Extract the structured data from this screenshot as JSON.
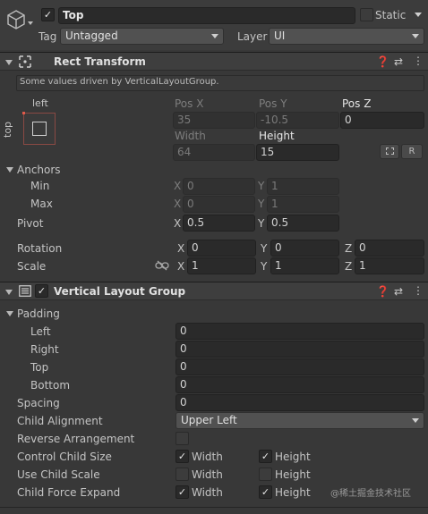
{
  "gameobject": {
    "name": "Top",
    "static_label": "Static",
    "tag_label": "Tag",
    "tag_value": "Untagged",
    "layer_label": "Layer",
    "layer_value": "UI"
  },
  "rect_transform": {
    "title": "Rect Transform",
    "driven_note": "Some values driven by VerticalLayoutGroup.",
    "anchor_h": "left",
    "anchor_v": "top",
    "col1_label": "Pos X",
    "col2_label": "Pos Y",
    "col3_label": "Pos Z",
    "pos_x": "35",
    "pos_y": "-10.5",
    "pos_z": "0",
    "width_label": "Width",
    "height_label": "Height",
    "width": "64",
    "height": "15",
    "raw_button": "R",
    "anchors_label": "Anchors",
    "min_label": "Min",
    "max_label": "Max",
    "min_x": "0",
    "min_y": "1",
    "max_x": "0",
    "max_y": "1",
    "pivot_label": "Pivot",
    "pivot_x": "0.5",
    "pivot_y": "0.5",
    "rotation_label": "Rotation",
    "rot_x": "0",
    "rot_y": "0",
    "rot_z": "0",
    "scale_label": "Scale",
    "scale_x": "1",
    "scale_y": "1",
    "scale_z": "1",
    "axis_x": "X",
    "axis_y": "Y",
    "axis_z": "Z"
  },
  "vlg": {
    "title": "Vertical Layout Group",
    "padding_label": "Padding",
    "left_label": "Left",
    "left": "0",
    "right_label": "Right",
    "right": "0",
    "top_label": "Top",
    "top": "0",
    "bottom_label": "Bottom",
    "bottom": "0",
    "spacing_label": "Spacing",
    "spacing": "0",
    "child_alignment_label": "Child Alignment",
    "child_alignment": "Upper Left",
    "reverse_label": "Reverse Arrangement",
    "control_size_label": "Control Child Size",
    "use_scale_label": "Use Child Scale",
    "force_expand_label": "Child Force Expand",
    "width_label": "Width",
    "height_label": "Height",
    "control_size": {
      "width": true,
      "height": true
    },
    "use_scale": {
      "width": false,
      "height": false
    },
    "force_expand": {
      "width": true,
      "height": true
    },
    "reverse": false
  },
  "watermark": "@稀土掘金技术社区"
}
